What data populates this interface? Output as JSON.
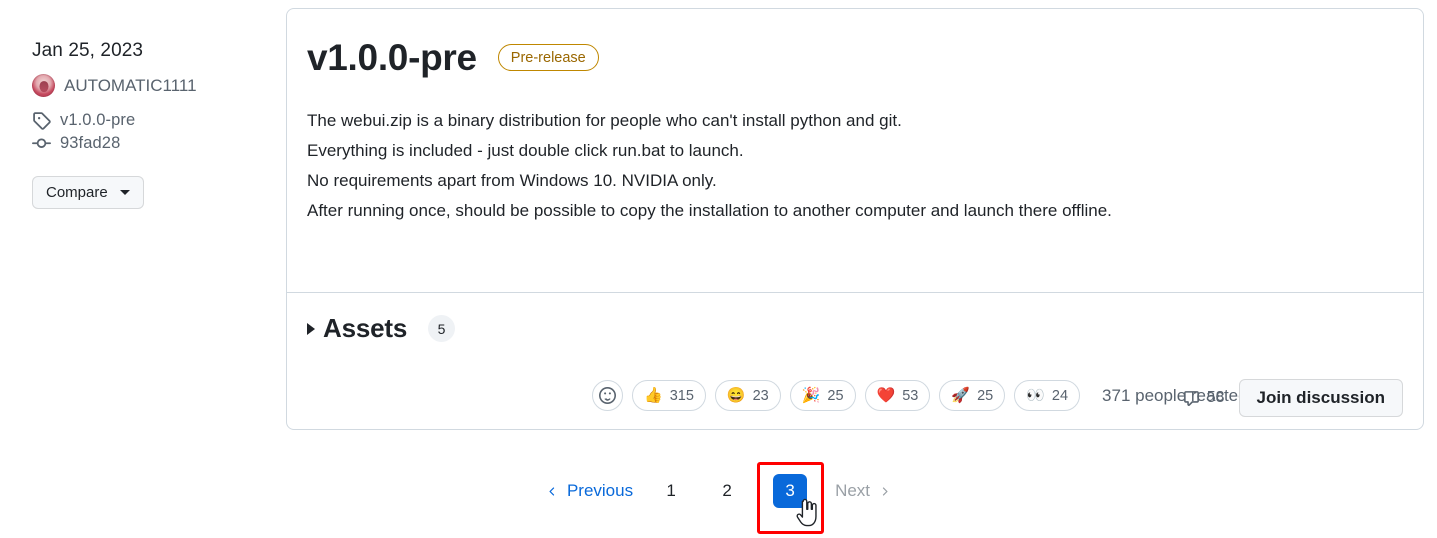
{
  "sidebar": {
    "date": "Jan 25, 2023",
    "author": "AUTOMATIC1111",
    "avatar_icon": "user-avatar",
    "tag": {
      "icon": "tag-icon",
      "label": "v1.0.0-pre"
    },
    "commit": {
      "icon": "commit-icon",
      "label": "93fad28"
    },
    "compare_button": {
      "label": "Compare",
      "icon": "chevron-down-icon"
    }
  },
  "release": {
    "title": "v1.0.0-pre",
    "badge": "Pre-release",
    "description_lines": [
      "The webui.zip is a binary distribution for people who can't install python and git.",
      "Everything is included - just double click run.bat to launch.",
      "No requirements apart from Windows 10. NVIDIA only.",
      "After running once, should be possible to copy the installation to another computer and launch there offline."
    ]
  },
  "assets": {
    "toggle_icon": "triangle-right-icon",
    "label": "Assets",
    "count": "5"
  },
  "reactions": {
    "add_icon": "smiley-plus-icon",
    "items": [
      {
        "emoji": "👍",
        "name": "thumbs-up",
        "count": "315"
      },
      {
        "emoji": "😄",
        "name": "laugh",
        "count": "23"
      },
      {
        "emoji": "🎉",
        "name": "hooray",
        "count": "25"
      },
      {
        "emoji": "❤️",
        "name": "heart",
        "count": "53"
      },
      {
        "emoji": "🚀",
        "name": "rocket",
        "count": "25"
      },
      {
        "emoji": "👀",
        "name": "eyes",
        "count": "24"
      }
    ],
    "summary": "371 people reacted"
  },
  "discussion": {
    "comment_icon": "comment-icon",
    "comment_count": "58",
    "join_label": "Join discussion"
  },
  "pagination": {
    "previous": {
      "label": "Previous",
      "icon": "chevron-left-icon"
    },
    "pages": [
      "1",
      "2",
      "3"
    ],
    "active_page": "3",
    "next": {
      "label": "Next",
      "icon": "chevron-right-icon"
    }
  },
  "colors": {
    "accent": "#0969da",
    "prerelease": "#bf8700",
    "muted": "#59636e",
    "border": "#d1d9e0",
    "highlight": "#ff0000"
  }
}
